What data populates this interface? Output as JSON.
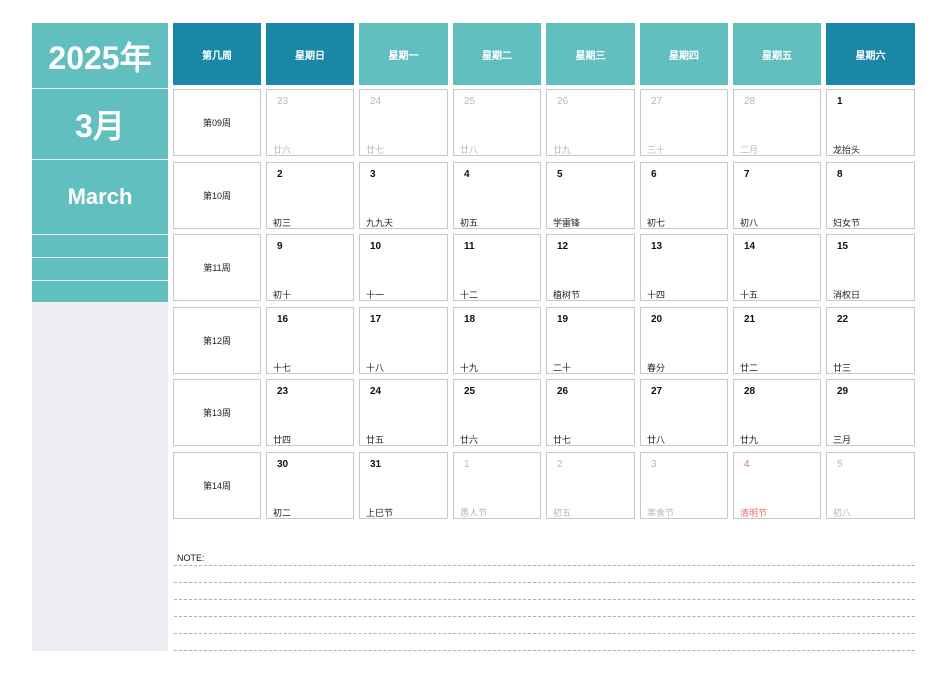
{
  "sidebar": {
    "year": "2025年",
    "month": "3月",
    "month_en": "March"
  },
  "headers": [
    "第几周",
    "星期日",
    "星期一",
    "星期二",
    "星期三",
    "星期四",
    "星期五",
    "星期六"
  ],
  "weeks": [
    {
      "label": "第09周",
      "days": [
        {
          "n": "23",
          "l": "廿六",
          "other": true
        },
        {
          "n": "24",
          "l": "廿七",
          "other": true
        },
        {
          "n": "25",
          "l": "廿八",
          "other": true
        },
        {
          "n": "26",
          "l": "廿九",
          "other": true
        },
        {
          "n": "27",
          "l": "三十",
          "other": true
        },
        {
          "n": "28",
          "l": "二月",
          "other": true
        },
        {
          "n": "1",
          "l": "龙抬头"
        }
      ]
    },
    {
      "label": "第10周",
      "days": [
        {
          "n": "2",
          "l": "初三"
        },
        {
          "n": "3",
          "l": "九九天"
        },
        {
          "n": "4",
          "l": "初五"
        },
        {
          "n": "5",
          "l": "学雷锋"
        },
        {
          "n": "6",
          "l": "初七"
        },
        {
          "n": "7",
          "l": "初八"
        },
        {
          "n": "8",
          "l": "妇女节"
        }
      ]
    },
    {
      "label": "第11周",
      "days": [
        {
          "n": "9",
          "l": "初十"
        },
        {
          "n": "10",
          "l": "十一"
        },
        {
          "n": "11",
          "l": "十二"
        },
        {
          "n": "12",
          "l": "植树节"
        },
        {
          "n": "13",
          "l": "十四"
        },
        {
          "n": "14",
          "l": "十五"
        },
        {
          "n": "15",
          "l": "消权日"
        }
      ]
    },
    {
      "label": "第12周",
      "days": [
        {
          "n": "16",
          "l": "十七"
        },
        {
          "n": "17",
          "l": "十八"
        },
        {
          "n": "18",
          "l": "十九"
        },
        {
          "n": "19",
          "l": "二十"
        },
        {
          "n": "20",
          "l": "春分"
        },
        {
          "n": "21",
          "l": "廿二"
        },
        {
          "n": "22",
          "l": "廿三"
        }
      ]
    },
    {
      "label": "第13周",
      "days": [
        {
          "n": "23",
          "l": "廿四"
        },
        {
          "n": "24",
          "l": "廿五"
        },
        {
          "n": "25",
          "l": "廿六"
        },
        {
          "n": "26",
          "l": "廿七"
        },
        {
          "n": "27",
          "l": "廿八"
        },
        {
          "n": "28",
          "l": "廿九"
        },
        {
          "n": "29",
          "l": "三月"
        }
      ]
    },
    {
      "label": "第14周",
      "days": [
        {
          "n": "30",
          "l": "初二"
        },
        {
          "n": "31",
          "l": "上巳节"
        },
        {
          "n": "1",
          "l": "愚人节",
          "other": true
        },
        {
          "n": "2",
          "l": "初五",
          "other": true
        },
        {
          "n": "3",
          "l": "寒食节",
          "other": true
        },
        {
          "n": "4",
          "l": "清明节",
          "other": true,
          "holiday": true
        },
        {
          "n": "5",
          "l": "初八",
          "other": true
        }
      ]
    }
  ],
  "note_label": "NOTE:",
  "colors": {
    "teal": "#62bfc0",
    "dark_teal": "#1a86a8",
    "holiday_red": "#e07070"
  }
}
